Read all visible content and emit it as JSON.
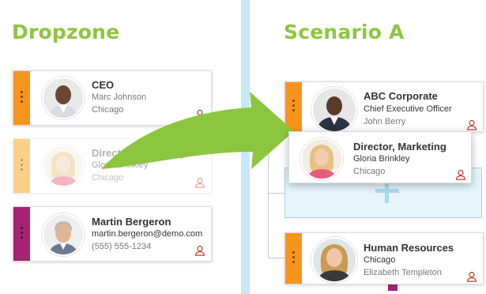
{
  "headings": {
    "dropzone": "Dropzone",
    "scenario": "Scenario A"
  },
  "colors": {
    "green": "#8cc63f",
    "orange": "#f7941d",
    "light_orange": "#fbd089",
    "purple": "#a3246f",
    "divider": "#c6e8f9"
  },
  "dropzone_cards": [
    {
      "title": "CEO",
      "line1": "Marc Johnson",
      "line2": "Chicago",
      "icon": "user-icon"
    },
    {
      "title": "Director, Marketing",
      "line1": "Gloria Brinkley",
      "line2": "Chicago",
      "icon": "user-icon"
    },
    {
      "title": "Martin Bergeron",
      "line1": "martin.bergeron@demo.com",
      "line2": "(555) 555-1234",
      "icon": "user-icon"
    }
  ],
  "scenario_cards": [
    {
      "title": "ABC Corporate",
      "line1": "Chief Executive Officer",
      "line2": "John Berry",
      "icon": "user-icon"
    },
    {
      "title": "Director, Marketing",
      "line1": "Gloria Brinkley",
      "line2": "Chicago",
      "icon": "user-icon"
    },
    {
      "title": "Human Resources",
      "line1": "Chicago",
      "line2": "Elizabeth Templeton",
      "icon": "user-icon"
    }
  ]
}
